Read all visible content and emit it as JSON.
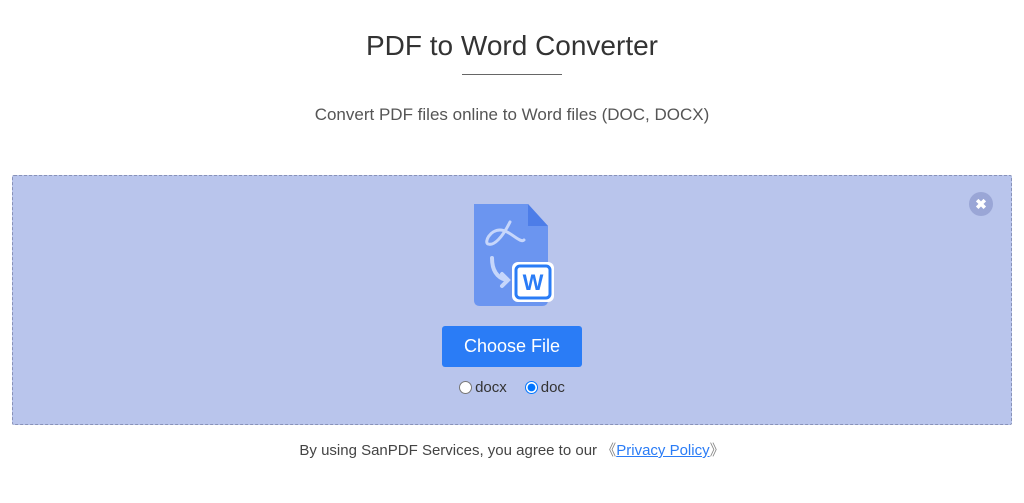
{
  "header": {
    "title": "PDF to Word Converter",
    "subtitle": "Convert PDF files online to Word files (DOC, DOCX)"
  },
  "dropzone": {
    "choose_file_label": "Choose File",
    "options": {
      "docx_label": "docx",
      "doc_label": "doc",
      "selected": "doc"
    }
  },
  "footer": {
    "agree_text": "By using SanPDF Services, you agree to our ",
    "open_bracket": "《",
    "privacy_link_text": "Privacy Policy",
    "close_bracket": "》"
  },
  "icons": {
    "close": "✖"
  }
}
